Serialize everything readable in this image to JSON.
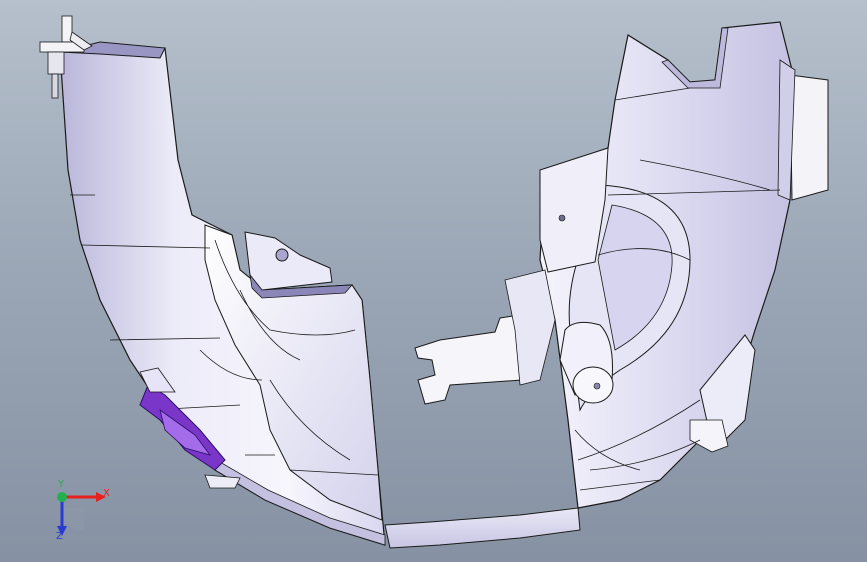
{
  "colors": {
    "background_top": "#b6c0cc",
    "background_bottom": "#8692a3",
    "part_fill_light": "#f2f1fb",
    "part_fill_mid": "#d9d7ef",
    "part_fill_dark": "#b9b6da",
    "part_edge": "#1a1a1a",
    "clip_purple": "#7a36c9",
    "axis_x": "#e8201c",
    "axis_y": "#22b14c",
    "axis_z": "#2a3bd4"
  },
  "triad": {
    "x_label": "X",
    "y_label": "Y",
    "z_label": "Z"
  }
}
